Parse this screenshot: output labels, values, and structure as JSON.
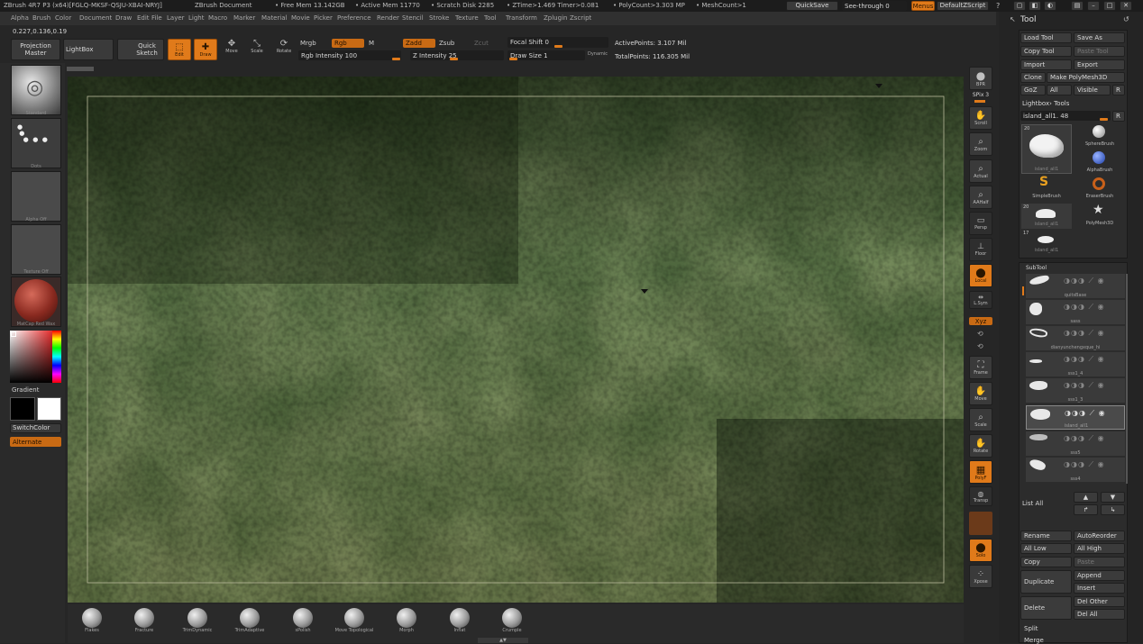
{
  "titlebar": {
    "app": "ZBrush 4R7 P3 (x64)[FGLQ-MKSF-QSJU-XBAI-NRYJ]",
    "doc": "ZBrush Document",
    "free_mem": "• Free Mem 13.142GB",
    "active_mem": "• Active Mem 11770",
    "scratch": "• Scratch Disk 2285",
    "ztime": "• ZTime>1.469 Timer>0.081",
    "polycount": "• PolyCount>3.303 MP",
    "meshcount": "• MeshCount>1",
    "quicksave": "QuickSave",
    "seethrough": "See-through  0",
    "menus": "Menus",
    "defaultzscript": "DefaultZScript"
  },
  "menu": [
    "Alpha",
    "Brush",
    "Color",
    "Document",
    "Draw",
    "Edit",
    "File",
    "Layer",
    "Light",
    "Macro",
    "Marker",
    "Material",
    "Movie",
    "Picker",
    "Preference",
    "Render",
    "Stencil",
    "Stroke",
    "Texture",
    "Tool",
    "Transform",
    "Zplugin",
    "Zscript"
  ],
  "coords": "0.227,0.136,0.19",
  "toolbar": {
    "projection_master": "Projection Master",
    "lightbox": "LightBox",
    "quick_sketch": "Quick Sketch",
    "edit": "Edit",
    "draw": "Draw",
    "move": "Move",
    "scale": "Scale",
    "rotate": "Rotate",
    "mrgb": "Mrgb",
    "rgb": "Rgb",
    "m": "M",
    "zadd": "Zadd",
    "zsub": "Zsub",
    "zcut": "Zcut",
    "rgb_intensity": "Rgb Intensity 100",
    "z_intensity": "Z Intensity 25",
    "focal_shift": "Focal Shift 0",
    "draw_size": "Draw Size 1",
    "dynamic": "Dynamic",
    "active_points": "ActivePoints: 3.107 Mil",
    "total_points": "TotalPoints: 116.305 Mil"
  },
  "left": {
    "brush_label": "Standard",
    "stroke_label": "Dots",
    "alpha_label": "Alpha Off",
    "texture_label": "Texture Off",
    "material_label": "MatCap Red Wax",
    "gradient": "Gradient",
    "switchcolor": "SwitchColor",
    "alternate": "Alternate"
  },
  "right_shelf": [
    {
      "name": "bpr",
      "label": "BPR"
    },
    {
      "name": "spix",
      "label": "SPix 3"
    },
    {
      "name": "scroll",
      "label": "Scroll"
    },
    {
      "name": "zoom",
      "label": "Zoom"
    },
    {
      "name": "actual",
      "label": "Actual"
    },
    {
      "name": "aahalf",
      "label": "AAHalf"
    },
    {
      "name": "persp",
      "label": "Persp"
    },
    {
      "name": "floor",
      "label": "Floor"
    },
    {
      "name": "local",
      "label": "Local"
    },
    {
      "name": "lsym",
      "label": "L.Sym"
    },
    {
      "name": "xyz",
      "label": "Xyz"
    },
    {
      "name": "frame",
      "label": "Frame"
    },
    {
      "name": "move",
      "label": "Move"
    },
    {
      "name": "scale",
      "label": "Scale"
    },
    {
      "name": "rotate",
      "label": "Rotate"
    },
    {
      "name": "polyf",
      "label": "PolyF"
    },
    {
      "name": "transp",
      "label": "Transp"
    },
    {
      "name": "solo",
      "label": "Solo"
    },
    {
      "name": "xpose",
      "label": "Xpose"
    }
  ],
  "tool": {
    "title": "Tool",
    "load_tool": "Load Tool",
    "save_as": "Save As",
    "copy_tool": "Copy Tool",
    "paste_tool": "Paste Tool",
    "import": "Import",
    "export": "Export",
    "clone": "Clone",
    "make_polymesh": "Make PolyMesh3D",
    "goz": "GoZ",
    "all": "All",
    "visible": "Visible",
    "r": "R",
    "lightbox_tools": "Lightbox› Tools",
    "current_tool": "island_all1. 48",
    "tools": [
      {
        "label": "island_all1",
        "count": "20"
      },
      {
        "label": "SphereBrush",
        "count": ""
      },
      {
        "label": "AlphaBrush",
        "count": ""
      },
      {
        "label": "SimpleBrush",
        "count": ""
      },
      {
        "label": "EraserBrush",
        "count": ""
      },
      {
        "label": "island_all1",
        "count": "20"
      },
      {
        "label": "PolyMesh3D",
        "count": ""
      },
      {
        "label": "island_all1",
        "count": "17"
      }
    ]
  },
  "subtool": {
    "title": "SubTool",
    "items": [
      "quitsBase",
      "sass",
      "dianyunchengxque_hi",
      "sss1_4",
      "sss1_3",
      "island_all1",
      "sss5",
      "sss4"
    ],
    "list_all": "List All",
    "rename": "Rename",
    "autoreorder": "AutoReorder",
    "all_low": "All Low",
    "all_high": "All High",
    "copy": "Copy",
    "paste": "Paste",
    "duplicate": "Duplicate",
    "append": "Append",
    "insert": "Insert",
    "delete": "Delete",
    "del_other": "Del Other",
    "del_all": "Del All",
    "split": "Split",
    "merge": "Merge"
  },
  "bottom_brushes": [
    "Flakes",
    "Fracture",
    "TrimDynamic",
    "TrimAdaptive",
    "sPolish",
    "Move Topological",
    "Morph",
    "Inflat",
    "Crumple"
  ]
}
